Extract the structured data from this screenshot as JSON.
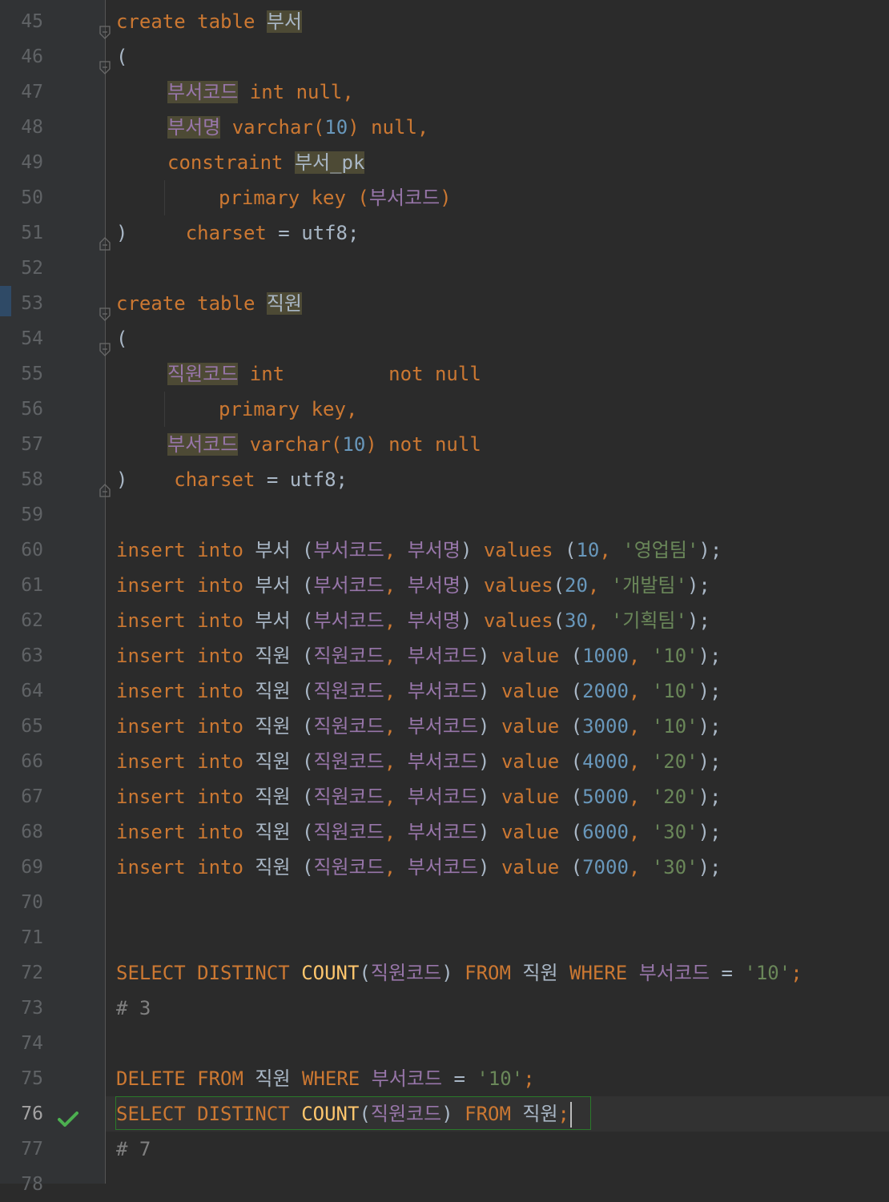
{
  "gutter": {
    "line_numbers": [
      "45",
      "46",
      "47",
      "48",
      "49",
      "50",
      "51",
      "52",
      "53",
      "54",
      "55",
      "56",
      "57",
      "58",
      "59",
      "60",
      "61",
      "62",
      "63",
      "64",
      "65",
      "66",
      "67",
      "68",
      "69",
      "70",
      "71",
      "72",
      "73",
      "74",
      "75",
      "76",
      "77",
      "78"
    ]
  },
  "code": {
    "l45": {
      "kw": "create table ",
      "tbl": "부서"
    },
    "l46": {
      "p": "("
    },
    "l47": {
      "col": "부서코드",
      "kw": " int null,"
    },
    "l48": {
      "col": "부서명",
      "kw1": " varchar(",
      "num": "10",
      "kw2": ") null,"
    },
    "l49": {
      "kw": "constraint ",
      "tbl": "부서_pk"
    },
    "l50": {
      "kw": "primary key ",
      "p1": "(",
      "col": "부서코드",
      "p2": ")"
    },
    "l51": {
      "p": ")",
      "kw": "charset",
      "rest": " = utf8;"
    },
    "l53": {
      "kw": "create table ",
      "tbl": "직원"
    },
    "l54": {
      "p": "("
    },
    "l55": {
      "col": "직원코드",
      "kw": " int         not null"
    },
    "l56": {
      "kw": "primary key,"
    },
    "l57": {
      "col": "부서코드",
      "kw1": " varchar(",
      "num": "10",
      "kw2": ") not null"
    },
    "l58": {
      "p": ")",
      "kw": "charset",
      "rest": " = utf8;"
    },
    "l60": {
      "kw": "insert into ",
      "tbl": "부서",
      "p1": " (",
      "c1": "부서코드",
      "p2": ", ",
      "c2": "부서명",
      "p3": ") ",
      "kw2": "values",
      "p4": " (",
      "num": "10",
      "p5": ", ",
      "str": "'영업팀'",
      "p6": ");"
    },
    "l61": {
      "kw": "insert into ",
      "tbl": "부서",
      "p1": " (",
      "c1": "부서코드",
      "p2": ", ",
      "c2": "부서명",
      "p3": ") ",
      "kw2": "values",
      "p4": "(",
      "num": "20",
      "p5": ", ",
      "str": "'개발팀'",
      "p6": ");"
    },
    "l62": {
      "kw": "insert into ",
      "tbl": "부서",
      "p1": " (",
      "c1": "부서코드",
      "p2": ", ",
      "c2": "부서명",
      "p3": ") ",
      "kw2": "values",
      "p4": "(",
      "num": "30",
      "p5": ", ",
      "str": "'기획팀'",
      "p6": ");"
    },
    "l63": {
      "kw": "insert into ",
      "tbl": "직원",
      "p1": " (",
      "c1": "직원코드",
      "p2": ", ",
      "c2": "부서코드",
      "p3": ") ",
      "kw2": "value",
      "p4": " (",
      "num": "1000",
      "p5": ", ",
      "str": "'10'",
      "p6": ");"
    },
    "l64": {
      "kw": "insert into ",
      "tbl": "직원",
      "p1": " (",
      "c1": "직원코드",
      "p2": ", ",
      "c2": "부서코드",
      "p3": ") ",
      "kw2": "value",
      "p4": " (",
      "num": "2000",
      "p5": ", ",
      "str": "'10'",
      "p6": ");"
    },
    "l65": {
      "kw": "insert into ",
      "tbl": "직원",
      "p1": " (",
      "c1": "직원코드",
      "p2": ", ",
      "c2": "부서코드",
      "p3": ") ",
      "kw2": "value",
      "p4": " (",
      "num": "3000",
      "p5": ", ",
      "str": "'10'",
      "p6": ");"
    },
    "l66": {
      "kw": "insert into ",
      "tbl": "직원",
      "p1": " (",
      "c1": "직원코드",
      "p2": ", ",
      "c2": "부서코드",
      "p3": ") ",
      "kw2": "value",
      "p4": " (",
      "num": "4000",
      "p5": ", ",
      "str": "'20'",
      "p6": ");"
    },
    "l67": {
      "kw": "insert into ",
      "tbl": "직원",
      "p1": " (",
      "c1": "직원코드",
      "p2": ", ",
      "c2": "부서코드",
      "p3": ") ",
      "kw2": "value",
      "p4": " (",
      "num": "5000",
      "p5": ", ",
      "str": "'20'",
      "p6": ");"
    },
    "l68": {
      "kw": "insert into ",
      "tbl": "직원",
      "p1": " (",
      "c1": "직원코드",
      "p2": ", ",
      "c2": "부서코드",
      "p3": ") ",
      "kw2": "value",
      "p4": " (",
      "num": "6000",
      "p5": ", ",
      "str": "'30'",
      "p6": ");"
    },
    "l69": {
      "kw": "insert into ",
      "tbl": "직원",
      "p1": " (",
      "c1": "직원코드",
      "p2": ", ",
      "c2": "부서코드",
      "p3": ") ",
      "kw2": "value",
      "p4": " (",
      "num": "7000",
      "p5": ", ",
      "str": "'30'",
      "p6": ");"
    },
    "l72": {
      "kw1": "SELECT DISTINCT ",
      "fn": "COUNT",
      "p1": "(",
      "c1": "직원코드",
      "p2": ") ",
      "kw2": "FROM ",
      "tbl": "직원",
      "kw3": " WHERE ",
      "c2": "부서코드",
      "p3": " = ",
      "str": "'10'",
      "p4": ";"
    },
    "l73": {
      "com": "# 3"
    },
    "l75": {
      "kw1": "DELETE FROM ",
      "tbl": "직원",
      "kw2": " WHERE ",
      "c1": "부서코드",
      "p1": " = ",
      "str": "'10'",
      "p2": ";"
    },
    "l76": {
      "kw1": "SELECT DISTINCT ",
      "fn": "COUNT",
      "p1": "(",
      "c1": "직원코드",
      "p2": ") ",
      "kw2": "FROM ",
      "tbl": "직원",
      "p3": ";"
    },
    "l77": {
      "com": "# 7"
    }
  },
  "colors": {
    "background": "#2b2b2b",
    "keyword": "#cc7832",
    "function": "#ffc66d",
    "number": "#6897bb",
    "string": "#6a8759",
    "column": "#9876aa",
    "comment": "#808080",
    "check": "#4caf50"
  },
  "icons": {
    "fold": "fold-marker-icon",
    "check": "checkmark-icon"
  }
}
